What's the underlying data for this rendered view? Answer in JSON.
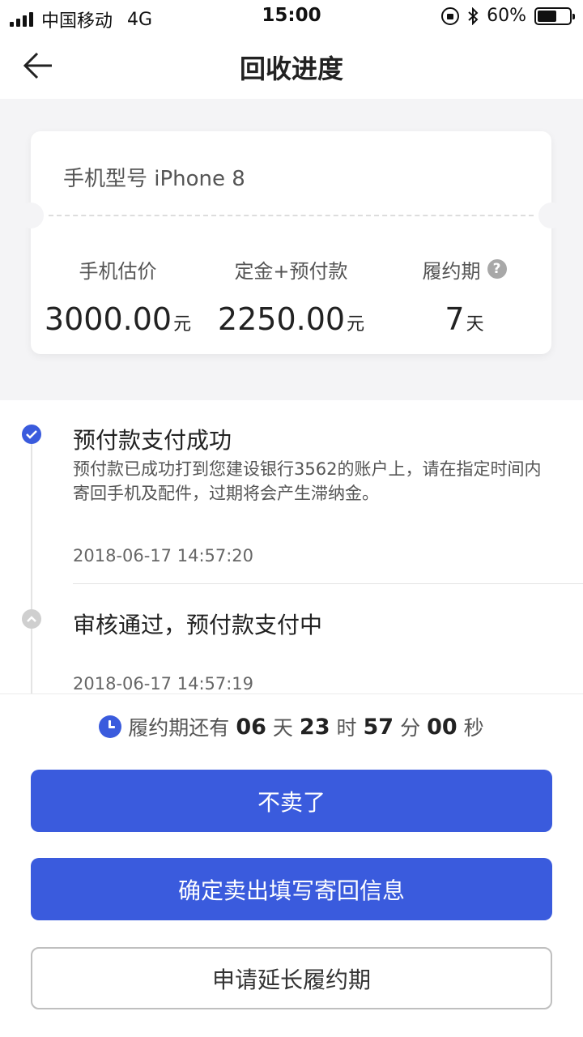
{
  "status_bar": {
    "carrier": "中国移动",
    "network": "4G",
    "time": "15:00",
    "battery": "60%",
    "battery_level": 0.6
  },
  "nav": {
    "title": "回收进度"
  },
  "card": {
    "model": "手机型号 iPhone 8",
    "columns": [
      {
        "label": "手机估价",
        "value": "3000.00",
        "unit": "元"
      },
      {
        "label": "定金+预付款",
        "value": "2250.00",
        "unit": "元"
      },
      {
        "label": "履约期",
        "value": "7",
        "unit": "天",
        "help": "?"
      }
    ]
  },
  "timeline": [
    {
      "title": "预付款支付成功",
      "desc": "预付款已成功打到您建设银行3562的账户上，请在指定时间内寄回手机及配件，过期将会产生滞纳金。",
      "time": "2018-06-17 14:57:20"
    },
    {
      "title": "审核通过，预付款支付中",
      "time": "2018-06-17 14:57:19"
    }
  ],
  "countdown": {
    "prefix": "履约期还有",
    "days": "06",
    "days_unit": "天",
    "hours": "23",
    "hours_unit": "时",
    "minutes": "57",
    "minutes_unit": "分",
    "seconds": "00",
    "seconds_unit": "秒"
  },
  "buttons": {
    "cancel": "不卖了",
    "confirm": "确定卖出填写寄回信息",
    "extend": "申请延长履约期"
  },
  "colors": {
    "accent": "#3a5bdd"
  }
}
